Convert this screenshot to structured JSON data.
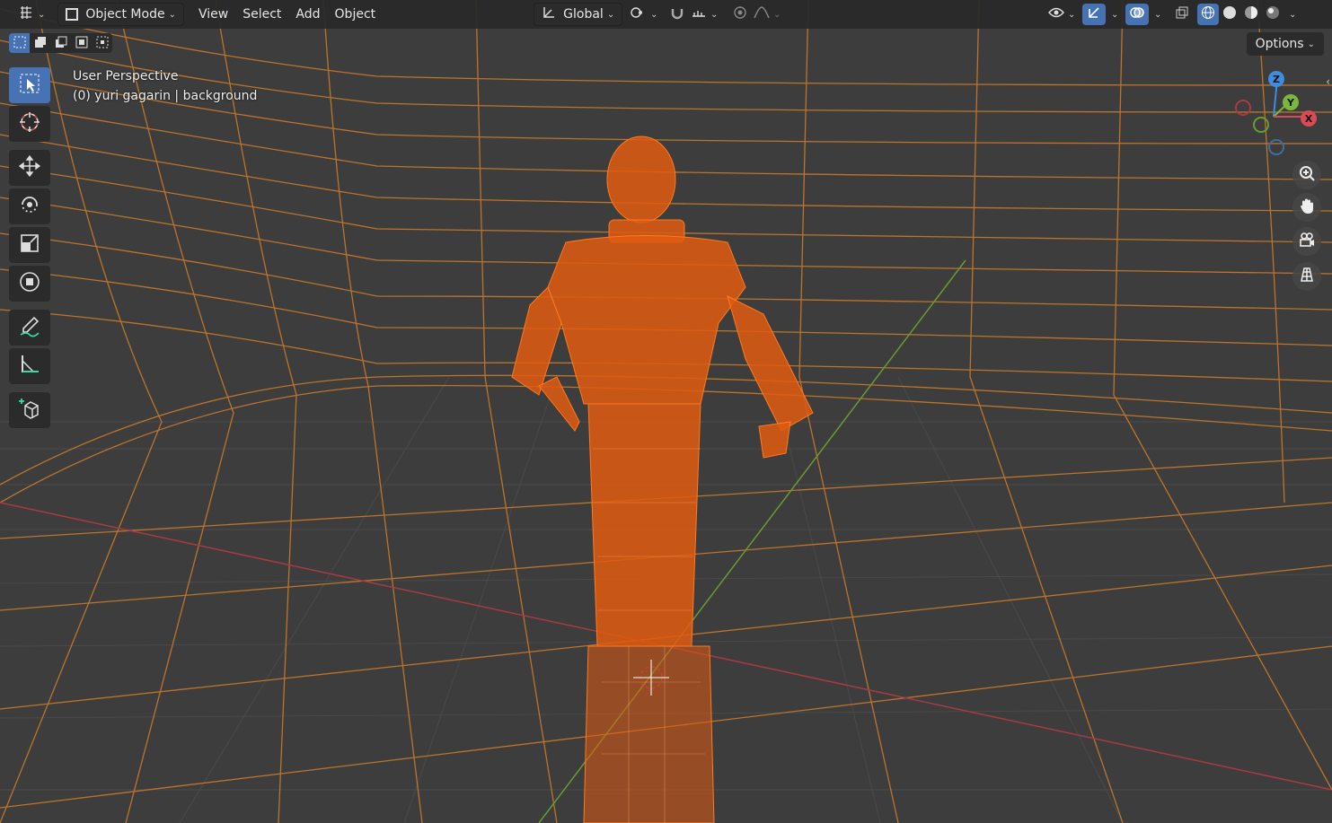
{
  "header": {
    "editor_type_icon": "grid-editor-icon",
    "mode_label": "Object Mode",
    "menus": [
      "View",
      "Select",
      "Add",
      "Object"
    ],
    "orientation_label": "Global"
  },
  "viewport_info": {
    "perspective": "User Perspective",
    "object_line": "(0) yuri gagarin | background"
  },
  "options_label": "Options",
  "gizmo": {
    "z": "Z",
    "y": "Y",
    "x": "X"
  },
  "colors": {
    "selection": "#ff6a00",
    "grid": "#e08a2c",
    "accent": "#4772b3",
    "x_axis": "#d94b55",
    "y_axis": "#7ab83b",
    "z_axis": "#3d8ee0"
  },
  "tools": [
    "select-box-tool",
    "cursor-tool",
    "move-tool",
    "rotate-tool",
    "scale-tool",
    "transform-tool",
    "annotate-tool",
    "measure-tool",
    "add-cube-tool"
  ],
  "nav_buttons": [
    "zoom-icon",
    "pan-hand-icon",
    "camera-icon",
    "ortho-grid-icon"
  ]
}
